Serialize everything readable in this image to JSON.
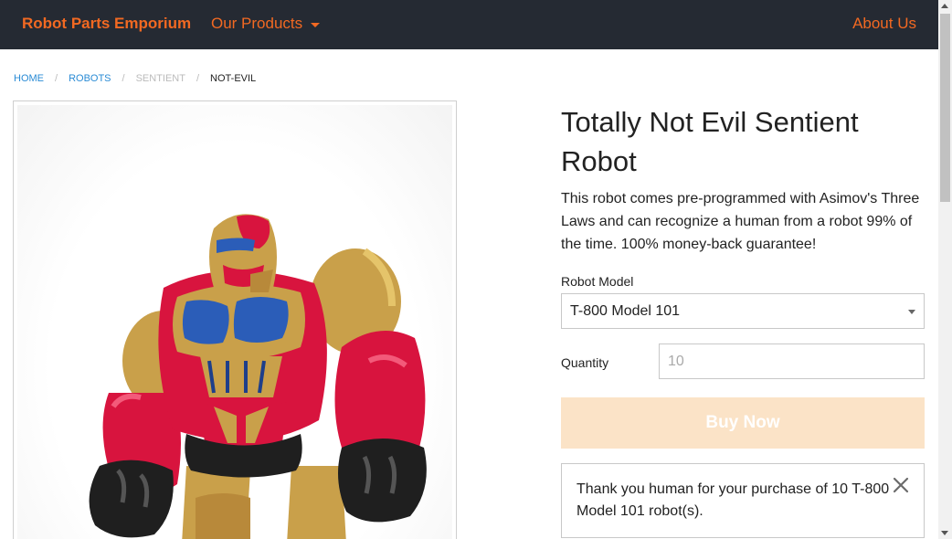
{
  "header": {
    "brand": "Robot Parts Emporium",
    "products_menu": "Our Products",
    "about": "About Us"
  },
  "breadcrumb": [
    "HOME",
    "ROBOTS",
    "SENTIENT",
    "NOT-EVIL"
  ],
  "product": {
    "title": "Totally Not Evil Sentient Robot",
    "description": "This robot comes pre-programmed with Asimov's Three Laws and can recognize a human from a robot 99% of the time. 100% money-back guarantee!",
    "image_alt": "toy robot",
    "model_label": "Robot Model",
    "model_selected": "T-800 Model 101",
    "quantity_label": "Quantity",
    "quantity_placeholder": "10",
    "buy_label": "Buy Now"
  },
  "callout": {
    "message": "Thank you human for your purchase of 10 T-800 Model 101 robot(s)."
  },
  "colors": {
    "nav_bg": "#252a33",
    "accent": "#f26922",
    "link": "#2a8bd5",
    "buy_disabled": "#fbe3c7"
  },
  "icons": {
    "dropdown": "chevron-down-icon",
    "close": "close-icon"
  }
}
